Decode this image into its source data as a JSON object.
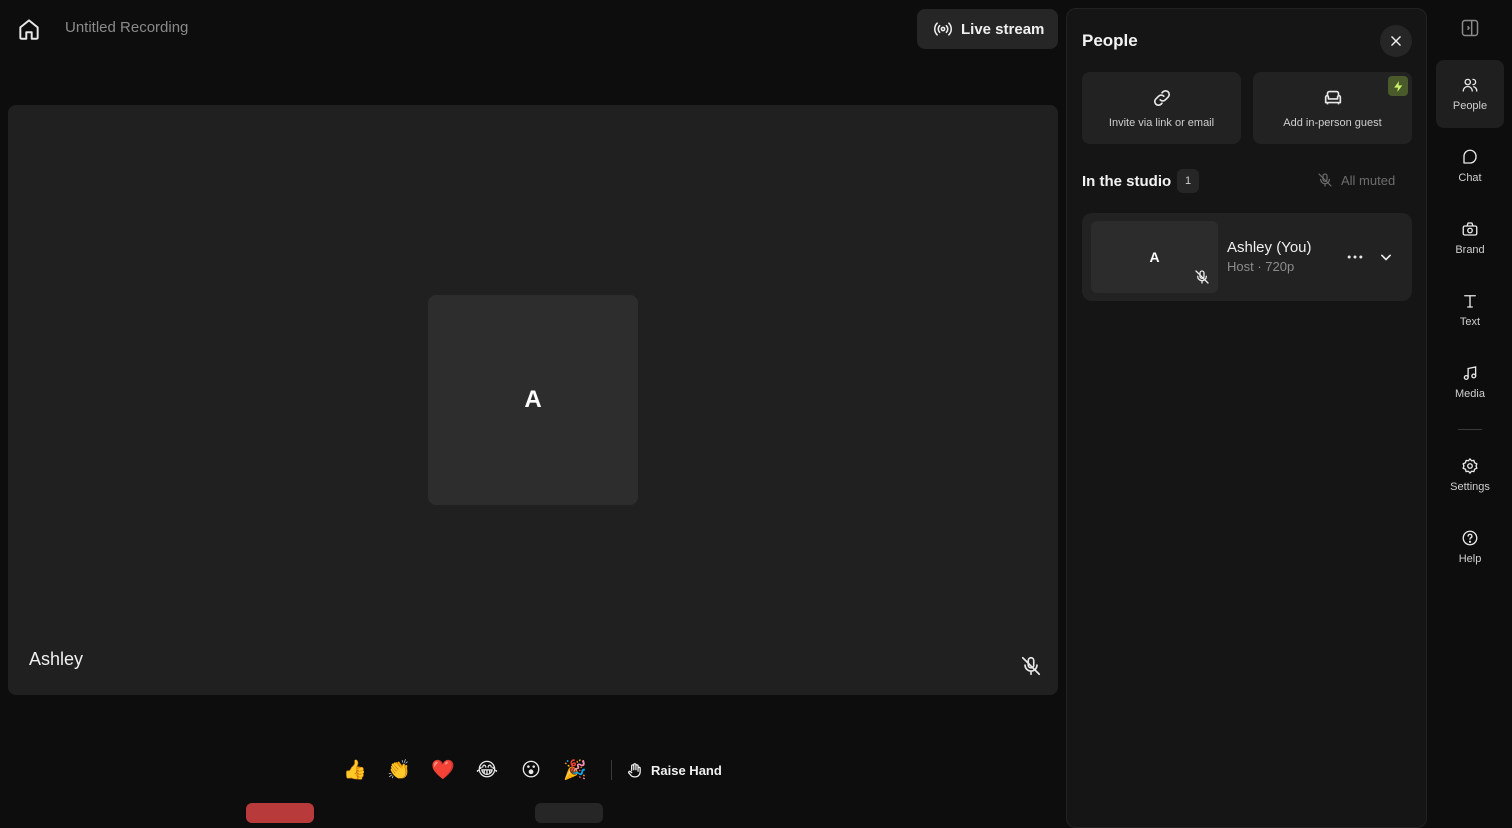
{
  "header": {
    "title": "Untitled Recording",
    "live_stream_label": "Live stream"
  },
  "stage": {
    "avatar_initial": "A",
    "participant_name": "Ashley"
  },
  "reactions": {
    "items": [
      "👍",
      "👏",
      "❤️",
      "😂",
      "😮",
      "🎉"
    ],
    "raise_hand_label": "Raise Hand"
  },
  "people_panel": {
    "title": "People",
    "invite_label": "Invite via link or email",
    "guest_label": "Add in-person guest",
    "studio_label": "In the studio",
    "studio_count": "1",
    "all_muted_label": "All muted",
    "participant": {
      "initial": "A",
      "name": "Ashley (You)",
      "role_quality": "Host · 720p"
    }
  },
  "rail": {
    "items": [
      {
        "label": "People",
        "icon": "people-icon"
      },
      {
        "label": "Chat",
        "icon": "chat-icon"
      },
      {
        "label": "Brand",
        "icon": "brand-icon"
      },
      {
        "label": "Text",
        "icon": "text-icon"
      },
      {
        "label": "Media",
        "icon": "music-icon"
      },
      {
        "label": "Settings",
        "icon": "gear-icon"
      },
      {
        "label": "Help",
        "icon": "help-icon"
      }
    ]
  },
  "colors": {
    "background": "#0d0d0d",
    "stage": "#202020",
    "panel": "#151515",
    "accent_red": "#b83a3a",
    "badge_green": "#4a5a2a"
  }
}
